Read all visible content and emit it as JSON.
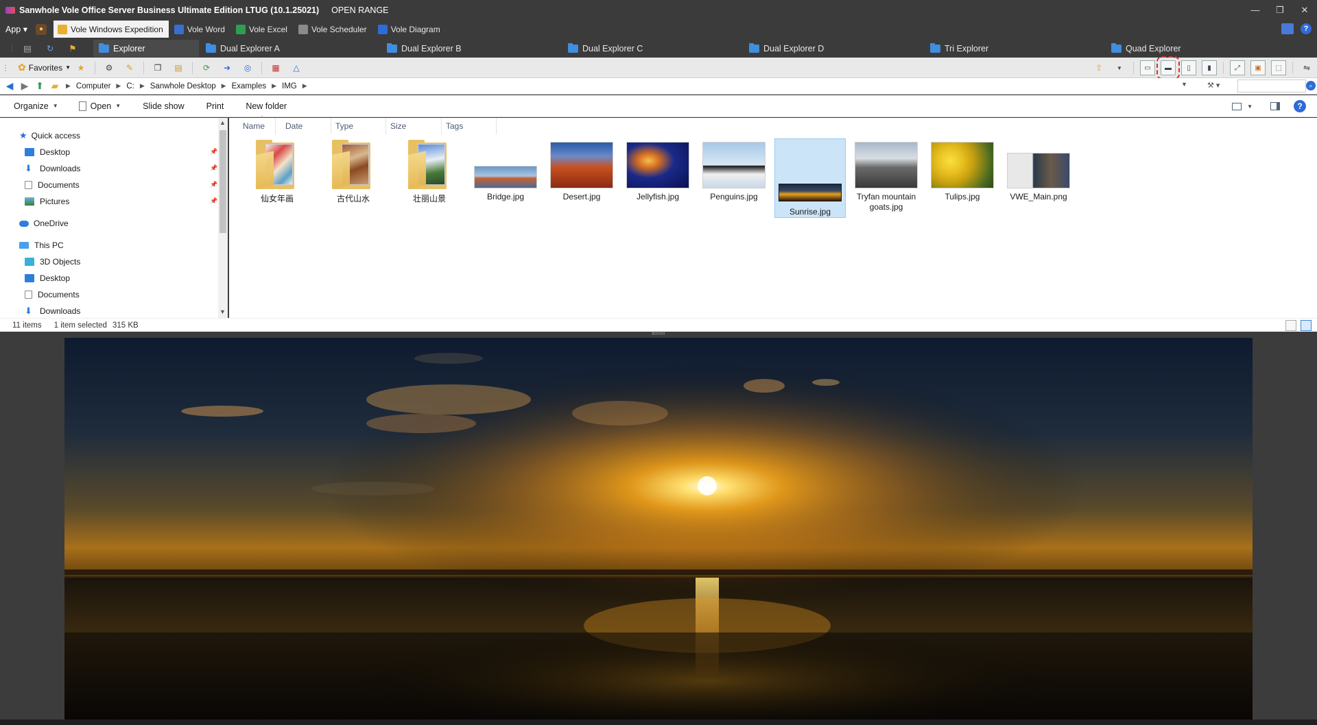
{
  "titlebar": {
    "title": "Sanwhole Vole Office Server Business Ultimate Edition LTUG (10.1.25021)",
    "subtitle": "OPEN RANGE",
    "controls": [
      "—",
      "❐",
      "✕"
    ]
  },
  "appbar": {
    "app_menu": "App ▾",
    "tabs": [
      {
        "label": "Vole Windows Expedition",
        "color": "#e8b030",
        "active": true
      },
      {
        "label": "Vole Word",
        "color": "#3a6fd0",
        "active": false
      },
      {
        "label": "Vole Excel",
        "color": "#2f9d4f",
        "active": false
      },
      {
        "label": "Vole Scheduler",
        "color": "#8a8a8a",
        "active": false
      },
      {
        "label": "Vole Diagram",
        "color": "#2e6bd8",
        "active": false
      }
    ],
    "help": "?"
  },
  "explorer_tabs": [
    {
      "label": "Explorer",
      "active": true
    },
    {
      "label": "Dual Explorer A",
      "active": false
    },
    {
      "label": "Dual Explorer B",
      "active": false
    },
    {
      "label": "Dual Explorer C",
      "active": false
    },
    {
      "label": "Dual Explorer D",
      "active": false
    },
    {
      "label": "Tri Explorer",
      "active": false
    },
    {
      "label": "Quad Explorer",
      "active": false
    }
  ],
  "toolbar": {
    "favorites_label": "Favorites"
  },
  "address": {
    "crumbs": [
      "Computer",
      "C:",
      "Sanwhole Desktop",
      "Examples",
      "IMG"
    ],
    "search_placeholder": ""
  },
  "commands": {
    "organize": "Organize",
    "open": "Open",
    "slideshow": "Slide show",
    "print": "Print",
    "new_folder": "New folder",
    "help": "?"
  },
  "nav": {
    "quick_access": "Quick access",
    "quick_items": [
      "Desktop",
      "Downloads",
      "Documents",
      "Pictures"
    ],
    "onedrive": "OneDrive",
    "this_pc": "This PC",
    "pc_items": [
      "3D Objects",
      "Desktop",
      "Documents",
      "Downloads"
    ]
  },
  "columns": [
    "Name",
    "Date",
    "Type",
    "Size",
    "Tags"
  ],
  "files": [
    {
      "name": "仙女年画",
      "kind": "folder"
    },
    {
      "name": "古代山水",
      "kind": "folder"
    },
    {
      "name": "壮丽山景",
      "kind": "folder"
    },
    {
      "name": "Bridge.jpg",
      "kind": "image"
    },
    {
      "name": "Desert.jpg",
      "kind": "image"
    },
    {
      "name": "Jellyfish.jpg",
      "kind": "image"
    },
    {
      "name": "Penguins.jpg",
      "kind": "image"
    },
    {
      "name": "Sunrise.jpg",
      "kind": "image",
      "selected": true
    },
    {
      "name": "Tryfan mountain goats.jpg",
      "kind": "image"
    },
    {
      "name": "Tulips.jpg",
      "kind": "image"
    },
    {
      "name": "VWE_Main.png",
      "kind": "image"
    }
  ],
  "status": {
    "count": "11 items",
    "selection": "1 item selected",
    "size": "315 KB"
  },
  "preview": {
    "file": "Sunrise.jpg"
  }
}
